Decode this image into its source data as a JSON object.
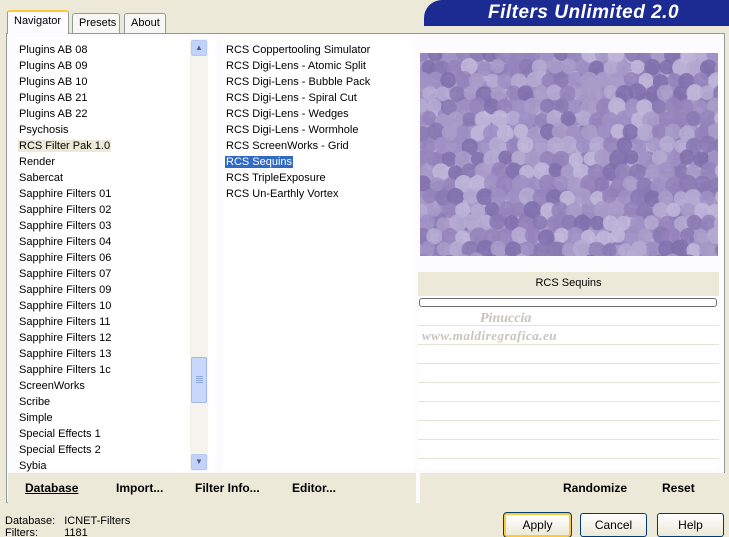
{
  "tabs": {
    "navigator": "Navigator",
    "presets": "Presets",
    "about": "About"
  },
  "banner_title": "Filters Unlimited 2.0",
  "categories": {
    "items": [
      "Plugins AB 08",
      "Plugins AB 09",
      "Plugins AB 10",
      "Plugins AB 21",
      "Plugins AB 22",
      "Psychosis",
      "RCS Filter Pak 1.0",
      "Render",
      "Sabercat",
      "Sapphire Filters 01",
      "Sapphire Filters 02",
      "Sapphire Filters 03",
      "Sapphire Filters 04",
      "Sapphire Filters 06",
      "Sapphire Filters 07",
      "Sapphire Filters 09",
      "Sapphire Filters 10",
      "Sapphire Filters 11",
      "Sapphire Filters 12",
      "Sapphire Filters 13",
      "Sapphire Filters 1c",
      "ScreenWorks",
      "Scribe",
      "Simple",
      "Special Effects 1",
      "Special Effects 2",
      "Sybia"
    ],
    "selected": "RCS Filter Pak 1.0"
  },
  "filters": {
    "items": [
      "RCS Coppertooling Simulator",
      "RCS Digi-Lens - Atomic Split",
      "RCS Digi-Lens - Bubble Pack",
      "RCS Digi-Lens - Spiral Cut",
      "RCS Digi-Lens - Wedges",
      "RCS Digi-Lens - Wormhole",
      "RCS ScreenWorks - Grid",
      "RCS Sequins",
      "RCS TripleExposure",
      "RCS Un-Earthly Vortex"
    ],
    "selected": "RCS Sequins"
  },
  "preview": {
    "filter_name": "RCS Sequins",
    "watermark_line1": "Pinuccia",
    "watermark_line2": "www.maldiregrafica.eu"
  },
  "toolbar": {
    "database": "Database",
    "import": "Import...",
    "filter_info": "Filter Info...",
    "editor": "Editor...",
    "randomize": "Randomize",
    "reset": "Reset"
  },
  "status": {
    "database_label": "Database:",
    "database_value": "ICNET-Filters",
    "filters_label": "Filters:",
    "filters_value": "1181"
  },
  "buttons": {
    "apply": "Apply",
    "cancel": "Cancel",
    "help": "Help"
  }
}
